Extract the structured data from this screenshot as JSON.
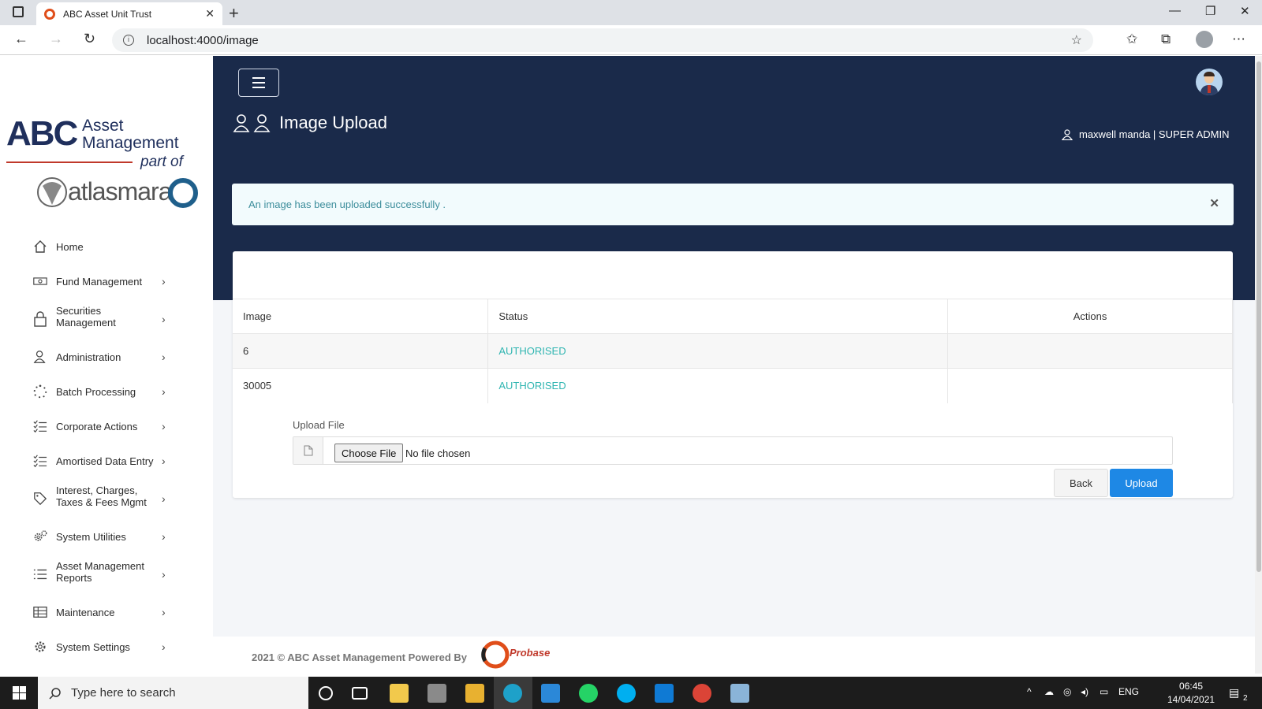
{
  "browser": {
    "tab_title": "ABC Asset Unit Trust",
    "url": "localhost:4000/image"
  },
  "sidebar": {
    "logo": {
      "line1": "ABC",
      "line2": "Asset",
      "line3": "Management",
      "line4": "part of",
      "brand": "atlasmara"
    },
    "items": [
      {
        "label": "Home",
        "icon": "home-icon",
        "has_children": false
      },
      {
        "label": "Fund Management",
        "icon": "money-icon",
        "has_children": true
      },
      {
        "label": "Securities Management",
        "icon": "lock-icon",
        "has_children": true
      },
      {
        "label": "Administration",
        "icon": "user-admin-icon",
        "has_children": true
      },
      {
        "label": "Batch Processing",
        "icon": "spinner-icon",
        "has_children": true
      },
      {
        "label": "Corporate Actions",
        "icon": "checklist-icon",
        "has_children": true
      },
      {
        "label": "Amortised Data Entry",
        "icon": "checklist-icon",
        "has_children": true
      },
      {
        "label": "Interest, Charges, Taxes & Fees Mgmt",
        "icon": "tag-icon",
        "has_children": true
      },
      {
        "label": "System Utilities",
        "icon": "gears-icon",
        "has_children": true
      },
      {
        "label": "Asset Management Reports",
        "icon": "list-icon",
        "has_children": true
      },
      {
        "label": "Maintenance",
        "icon": "table-icon",
        "has_children": true
      },
      {
        "label": "System Settings",
        "icon": "gear-icon",
        "has_children": true
      }
    ]
  },
  "header": {
    "page_title": "Image Upload",
    "user": "maxwell manda | SUPER ADMIN"
  },
  "alert": {
    "message": "An image has been uploaded successfully ."
  },
  "table": {
    "columns": [
      "Image",
      "Status",
      "Actions"
    ],
    "rows": [
      {
        "image": "6",
        "status": "AUTHORISED",
        "actions": ""
      },
      {
        "image": "30005",
        "status": "AUTHORISED",
        "actions": ""
      }
    ]
  },
  "upload": {
    "label": "Upload File",
    "choose_button": "Choose File",
    "file_status": "No file chosen",
    "back_label": "Back",
    "upload_label": "Upload"
  },
  "footer": {
    "text": "2021 © ABC Asset Management Powered By",
    "logo_text": "Probase"
  },
  "taskbar": {
    "search_placeholder": "Type here to search",
    "language": "ENG",
    "time": "06:45",
    "date": "14/04/2021",
    "notification_count": "2"
  },
  "colors": {
    "hero": "#1a2a4a",
    "status_authorised": "#2fb5b1",
    "primary_button": "#1e88e5",
    "alert_bg": "#f2fbfd"
  }
}
